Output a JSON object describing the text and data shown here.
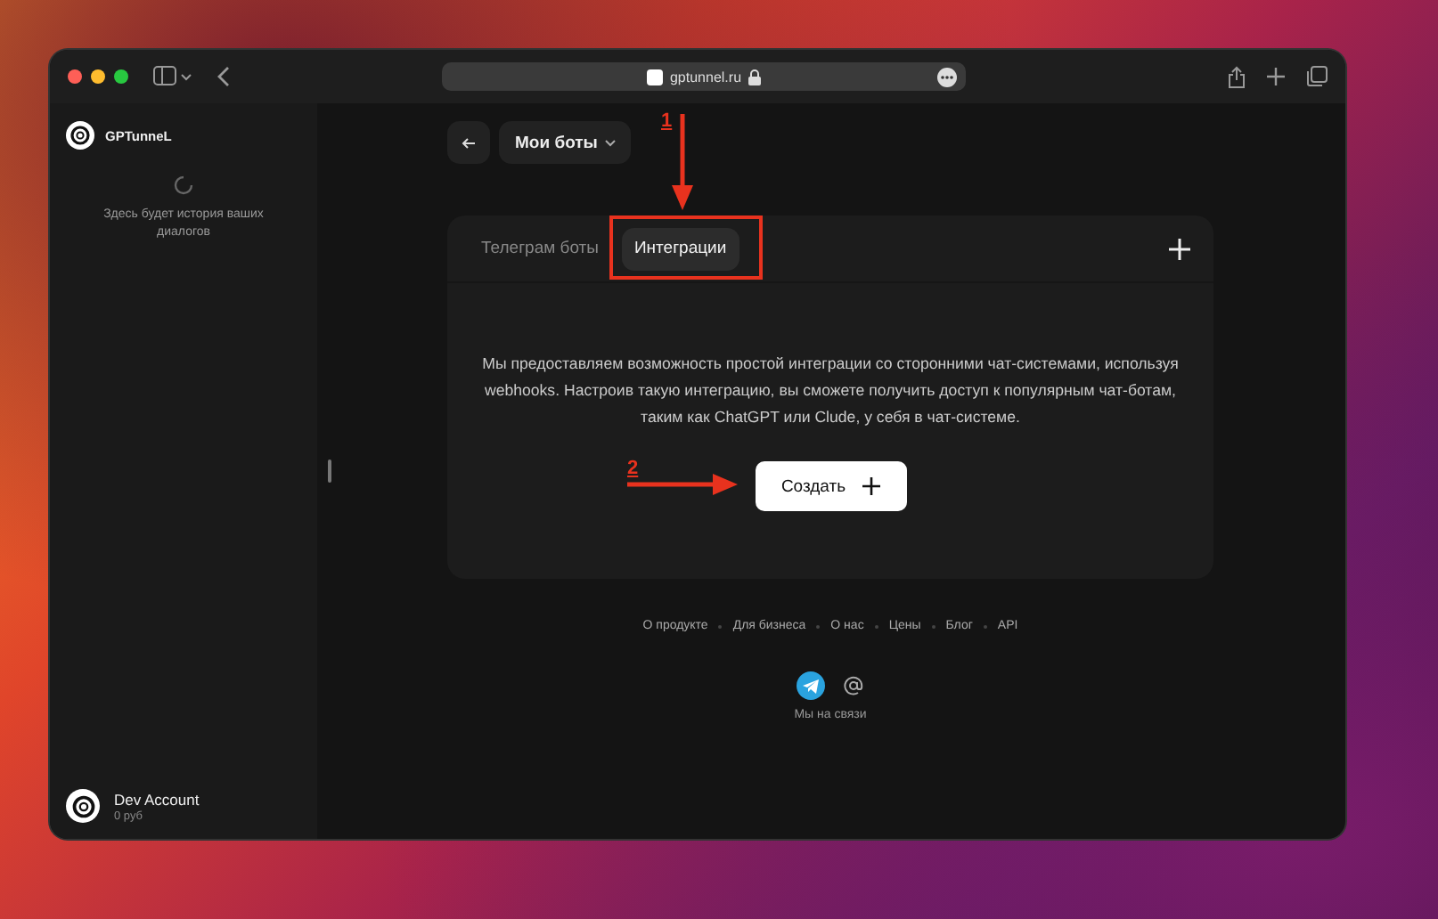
{
  "browser": {
    "url": "gptunnel.ru"
  },
  "sidebar": {
    "brand": "GPTunneL",
    "empty_text": "Здесь будет история ваших диалогов",
    "account": {
      "name": "Dev Account",
      "balance": "0 руб"
    }
  },
  "header": {
    "title": "Мои боты"
  },
  "tabs": [
    {
      "label": "Телеграм боты",
      "selected": false
    },
    {
      "label": "Интеграции",
      "selected": true
    }
  ],
  "description": "Мы предоставляем возможность простой интеграции со сторонними чат-системами, используя webhooks. Настроив такую интеграцию, вы сможете получить доступ к популярным чат-ботам, таким как ChatGPT или Clude, у себя в чат-системе.",
  "create_button": "Создать",
  "footer": {
    "links": [
      "О продукте",
      "Для бизнеса",
      "О нас",
      "Цены",
      "Блог",
      "API"
    ],
    "contact_label": "Мы на связи"
  },
  "annotations": [
    {
      "kind": "frame"
    },
    {
      "kind": "arrow_down",
      "label": "1"
    },
    {
      "kind": "arrow_right",
      "label": "2"
    }
  ]
}
